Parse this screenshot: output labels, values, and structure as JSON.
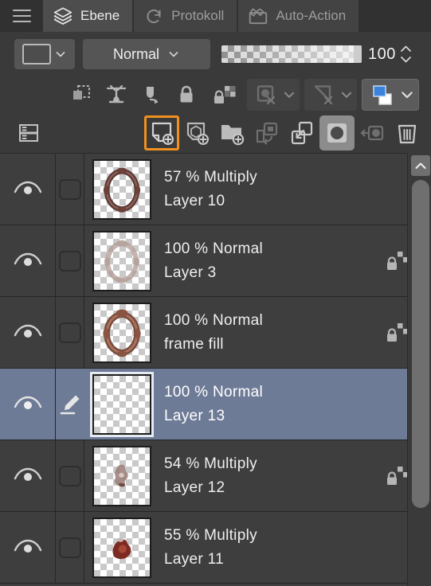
{
  "window": {
    "title": "Ebene"
  },
  "tabs": [
    {
      "label": "Ebene",
      "icon": "layers-icon",
      "active": true
    },
    {
      "label": "Protokoll",
      "icon": "history-icon",
      "active": false
    },
    {
      "label": "Auto-Action",
      "icon": "clapboard-icon",
      "active": false
    }
  ],
  "menu": {
    "icon": "hamburger-menu-icon"
  },
  "blend": {
    "swatch_icon": "layer-color-swatch",
    "mode": "Normal",
    "mode_caret": "chevron-down-icon"
  },
  "opacity": {
    "value": "100",
    "slider_position_percent": 100,
    "spinner_up": "spinner-up-icon",
    "spinner_down": "spinner-down-icon"
  },
  "lock_toolbar": [
    {
      "name": "clip-to-layer-below-icon",
      "enabled": true
    },
    {
      "name": "reference-layer-icon",
      "enabled": true
    },
    {
      "name": "draft-layer-icon",
      "enabled": true
    },
    {
      "name": "lock-layer-icon",
      "enabled": true
    },
    {
      "name": "lock-transparent-pixels-icon",
      "enabled": true
    },
    {
      "name": "layer-mask-enable-icon",
      "enabled": false
    },
    {
      "name": "layer-mask-enable-caret",
      "enabled": false
    },
    {
      "name": "ruler-mask-icon",
      "enabled": false
    },
    {
      "name": "ruler-mask-caret",
      "enabled": false
    },
    {
      "name": "layer-color-icon",
      "enabled": true
    },
    {
      "name": "layer-color-caret",
      "enabled": true
    }
  ],
  "action_toolbar": {
    "palette_settings_icon": "layer-list-settings-icon",
    "buttons": [
      {
        "name": "new-raster-layer-button",
        "icon": "new-raster-layer-icon",
        "state": "selected"
      },
      {
        "name": "new-3d-layer-button",
        "icon": "new-3d-layer-icon",
        "state": "normal"
      },
      {
        "name": "new-layer-folder-button",
        "icon": "new-folder-icon",
        "state": "normal"
      },
      {
        "name": "transfer-to-lower-button",
        "icon": "transfer-down-icon",
        "state": "disabled"
      },
      {
        "name": "combine-to-lower-button",
        "icon": "merge-down-icon",
        "state": "normal"
      },
      {
        "name": "create-layer-mask-button",
        "icon": "layer-mask-icon",
        "state": "on"
      },
      {
        "name": "apply-mask-button",
        "icon": "apply-mask-icon",
        "state": "disabled"
      },
      {
        "name": "delete-layer-button",
        "icon": "trash-icon",
        "state": "normal"
      }
    ]
  },
  "layers": [
    {
      "opacity": "57 %",
      "blend": "Multiply",
      "mode_line": "57 % Multiply",
      "name": "Layer 10",
      "visible": true,
      "selected": false,
      "locked": false,
      "thumb": "ornate-oval-frame-dark"
    },
    {
      "opacity": "100 %",
      "blend": "Normal",
      "mode_line": "100 % Normal",
      "name": "Layer 3",
      "visible": true,
      "selected": false,
      "locked": true,
      "thumb": "ornate-oval-frame-pale"
    },
    {
      "opacity": "100 %",
      "blend": "Normal",
      "mode_line": "100 % Normal",
      "name": "frame fill",
      "visible": true,
      "selected": false,
      "locked": true,
      "thumb": "ornate-oval-frame-solid"
    },
    {
      "opacity": "100 %",
      "blend": "Normal",
      "mode_line": "100 % Normal",
      "name": "Layer 13",
      "visible": true,
      "selected": true,
      "locked": false,
      "thumb": "empty-transparent"
    },
    {
      "opacity": "54 %",
      "blend": "Multiply",
      "mode_line": "54 % Multiply",
      "name": "Layer 12",
      "visible": true,
      "selected": false,
      "locked": true,
      "thumb": "small-pale-blob"
    },
    {
      "opacity": "55 %",
      "blend": "Multiply",
      "mode_line": "55 % Multiply",
      "name": "Layer 11",
      "visible": true,
      "selected": false,
      "locked": false,
      "thumb": "small-red-blob"
    }
  ],
  "scrollbar": {
    "up_arrow_icon": "chevron-up-icon"
  },
  "colors": {
    "panel_bg": "#3a3a3a",
    "list_bg": "#3e3e3e",
    "tab_active_bg": "#4d4d4d",
    "selection": "#6e7b96",
    "accent_orange": "#f0901e",
    "layer_color_blue": "#3b82dc",
    "text": "#efefef"
  }
}
